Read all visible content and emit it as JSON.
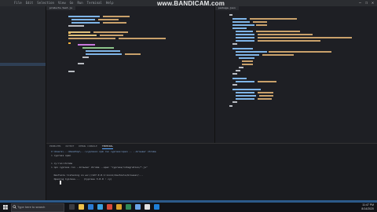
{
  "menu": {
    "items": [
      "File",
      "Edit",
      "Selection",
      "View",
      "Go",
      "Run",
      "Terminal",
      "Help"
    ]
  },
  "watermark": "www.BANDICAM.com",
  "window_controls": [
    "—",
    "❐",
    "✕"
  ],
  "tabs": {
    "left": "products.test.js",
    "right": "package.json"
  },
  "terminal": {
    "tabs": [
      "PROBLEMS",
      "OUTPUT",
      "DEBUG CONSOLE",
      "TERMINAL"
    ],
    "lines": [
      "C:\\Users\\...\\Desktop\\...\\cypress> npm run cypress:open -- --browser chrome",
      "> cypress open",
      "",
      "> cy:run:chrome",
      "> npx cypress run --browser chrome --spec \"cypress/integration/*.js\"",
      "",
      "  DevTools listening on ws://127.0.0.1:xxxxx/devtools/browser/...",
      "  Opening Cypress...   (Cypress 3.8.0 : cy)"
    ]
  },
  "taskbar": {
    "search_placeholder": "Type here to search",
    "time": "11:47 PM",
    "date": "8/14/2020"
  },
  "colors": {
    "statusbar": "#2c5a8a",
    "accent": "#58a6ff"
  }
}
